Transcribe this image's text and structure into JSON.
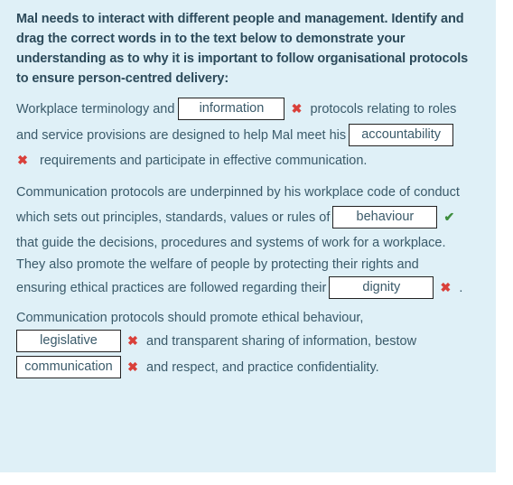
{
  "question": {
    "prompt": "Mal needs to interact with different people and management. Identify and drag the correct words in to the text below to demonstrate your understanding as to why it is important to follow organisational protocols to ensure person-centred delivery:"
  },
  "paragraph1": {
    "t1": "Workplace terminology and",
    "drop1": {
      "value": "information",
      "status": "incorrect"
    },
    "t2": "protocols relating to roles",
    "t3": "and service provisions are designed to help Mal meet his",
    "drop2": {
      "value": "accountability",
      "status": "incorrect"
    },
    "t4": "requirements and participate in effective communication."
  },
  "paragraph2": {
    "t1": "Communication protocols are underpinned by his workplace code of conduct",
    "t2": "which sets out principles, standards, values or rules of",
    "drop3": {
      "value": "behaviour",
      "status": "correct"
    },
    "t3": "that guide the decisions, procedures and systems of work for a workplace.",
    "t4": "They also promote the welfare of people by protecting their rights and",
    "t5": "ensuring ethical practices are followed regarding their",
    "drop4": {
      "value": "dignity",
      "status": "incorrect"
    },
    "t6": "."
  },
  "paragraph3": {
    "t1": "Communication protocols should promote ethical behaviour,",
    "drop5": {
      "value": "legislative",
      "status": "incorrect"
    },
    "t2": "and transparent sharing of information, bestow",
    "drop6": {
      "value": "communication",
      "status": "incorrect"
    },
    "t3": "and respect, and practice confidentiality."
  },
  "icons": {
    "incorrect": "✖",
    "correct": "✔"
  },
  "colors": {
    "panel_bg": "#dff0f7",
    "incorrect": "#d9403a",
    "correct": "#3e8e3e",
    "text": "#3a5a6a"
  }
}
